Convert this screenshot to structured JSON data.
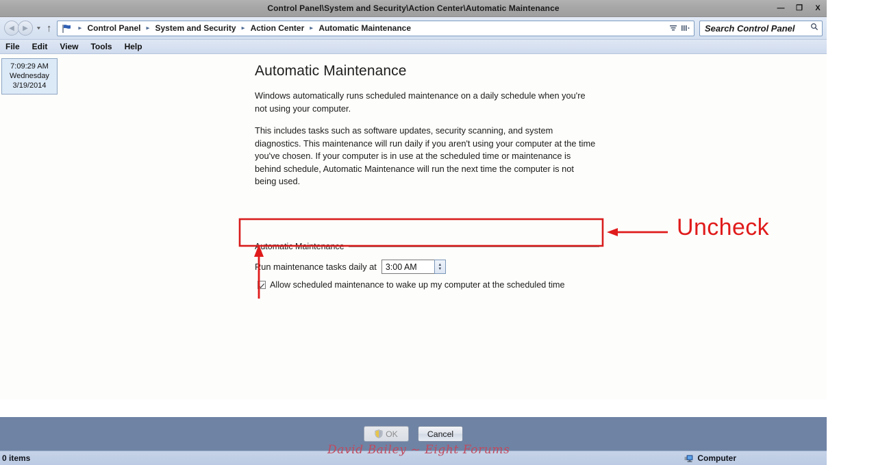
{
  "window": {
    "title": "Control Panel\\System and Security\\Action Center\\Automatic Maintenance",
    "buttons": {
      "minimize": "—",
      "restore": "❐",
      "close": "X"
    }
  },
  "nav": {
    "back_icon": "◀",
    "forward_icon": "▶",
    "history_caret": "▼",
    "up_icon": "↑",
    "breadcrumbs": [
      "Control Panel",
      "System and Security",
      "Action Center",
      "Automatic Maintenance"
    ],
    "separator": "▸",
    "refresh_icon": "refresh-icon",
    "previous_locations_icon": "previous-locations-icon"
  },
  "search": {
    "placeholder": "Search Control Panel",
    "icon": "🔍"
  },
  "menubar": {
    "items": [
      "File",
      "Edit",
      "View",
      "Tools",
      "Help"
    ]
  },
  "clock": {
    "time": "7:09:29 AM",
    "weekday": "Wednesday",
    "date": "3/19/2014"
  },
  "content": {
    "title": "Automatic Maintenance",
    "paragraph1": "Windows automatically runs scheduled maintenance on a daily schedule when you're not using your computer.",
    "paragraph2": "This includes tasks such as software updates, security scanning, and system diagnostics. This maintenance will run daily if you aren't using your computer at the time you've chosen. If your computer is in use at the scheduled time or maintenance is behind schedule, Automatic Maintenance will run the next time the computer is not being used."
  },
  "groupbox": {
    "legend": "Automatic Maintenance",
    "time_label": "Run maintenance tasks daily at",
    "time_value": "3:00 AM",
    "spinner_up": "▲",
    "spinner_down": "▼",
    "checkbox_label": "Allow scheduled maintenance to wake up my computer at the scheduled time",
    "checkbox_checked": true
  },
  "annotation": {
    "text": "Uncheck",
    "color": "#e01b1b"
  },
  "dialog_buttons": {
    "ok": "OK",
    "cancel": "Cancel",
    "ok_disabled": true,
    "ok_icon": "uac-shield-icon"
  },
  "watermark": "David Bailey ~ Eight Forums",
  "statusbar": {
    "left": "0 items",
    "right": "Computer",
    "right_icon": "computer-icon"
  }
}
